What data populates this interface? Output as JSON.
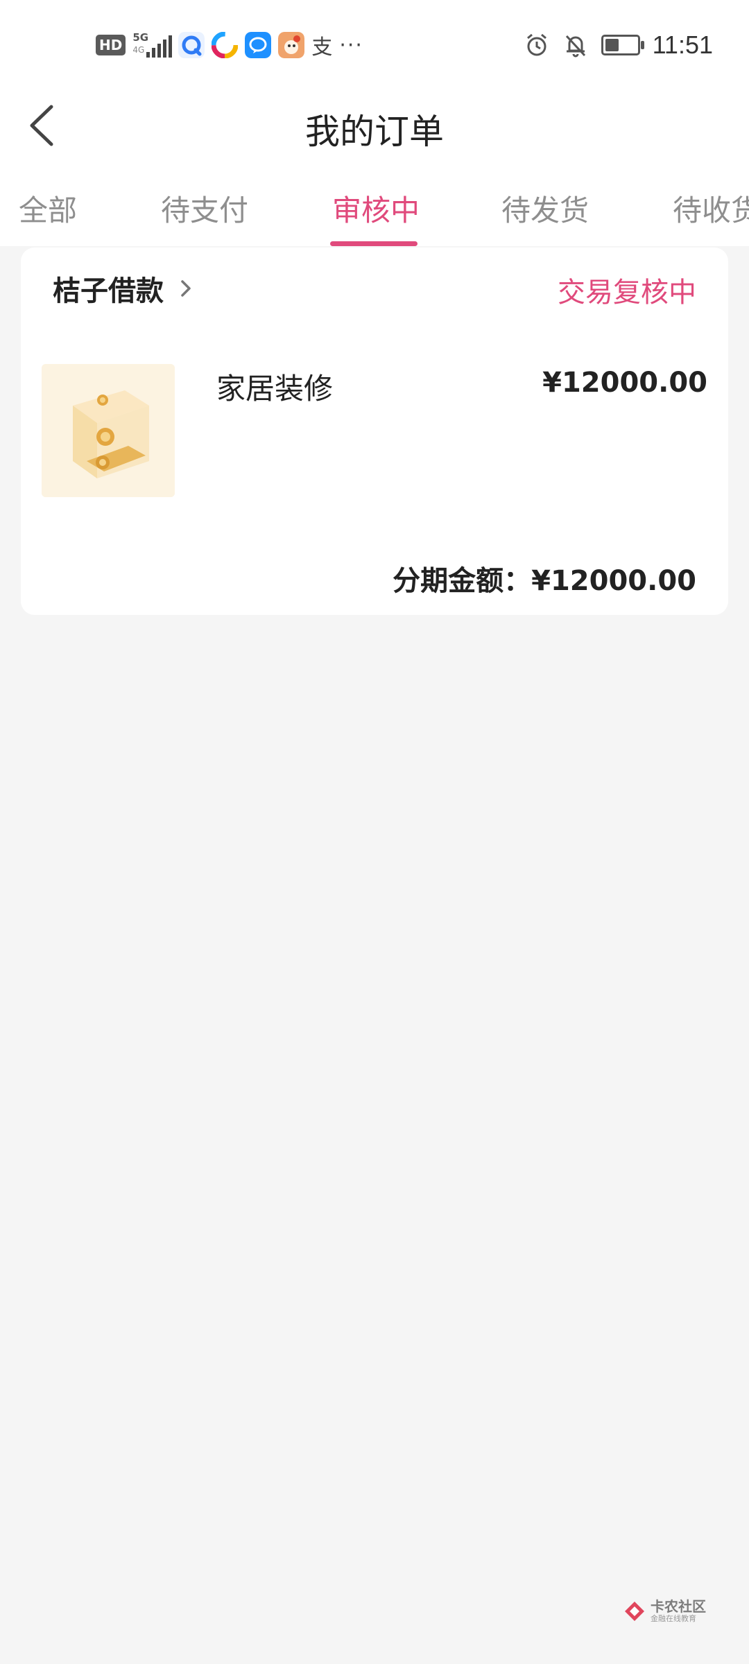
{
  "status_bar": {
    "hd_label": "HD",
    "network_label": "5G",
    "network_sub": "4G",
    "alipay_glyph": "支",
    "more_dots": "···",
    "time": "11:51",
    "battery_level": 0.45
  },
  "header": {
    "title": "我的订单",
    "back_icon": "chevron-left-icon"
  },
  "tabs": [
    {
      "label": "全部",
      "active": false
    },
    {
      "label": "待支付",
      "active": false
    },
    {
      "label": "审核中",
      "active": true
    },
    {
      "label": "待发货",
      "active": false
    },
    {
      "label": "待收货",
      "active": false
    }
  ],
  "order": {
    "merchant": "桔子借款",
    "status": "交易复核中",
    "product_name": "家居装修",
    "price": "¥12000.00",
    "total_label": "分期金额：",
    "total_value": "¥12000.00"
  },
  "watermark": {
    "name": "卡农社区",
    "slogan": "金融在线教育"
  },
  "colors": {
    "accent": "#e04a7c",
    "background": "#f5f5f5",
    "card": "#ffffff"
  }
}
